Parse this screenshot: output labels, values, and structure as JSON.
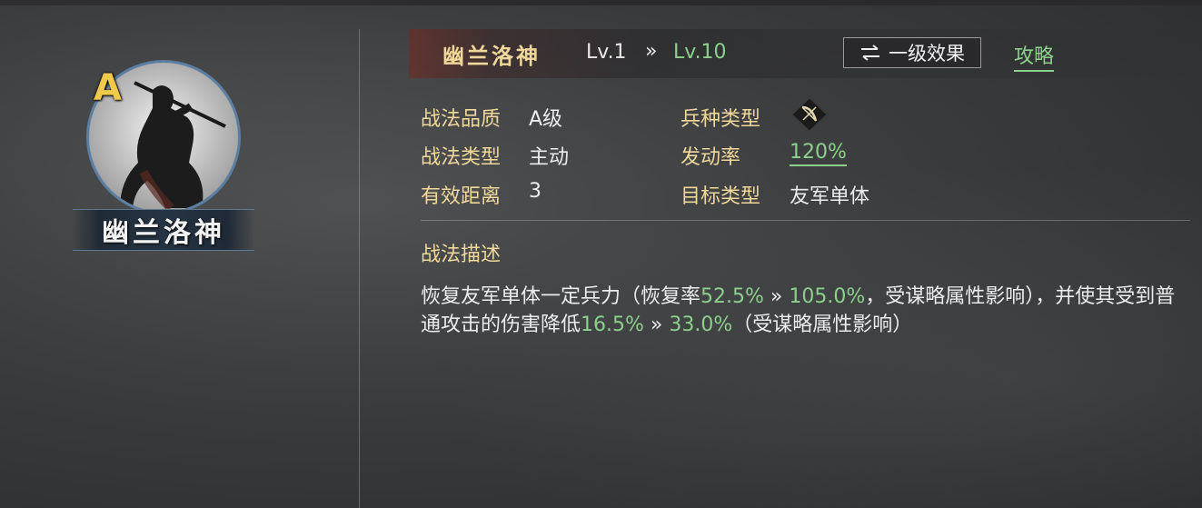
{
  "portrait": {
    "grade": "A",
    "name": "幽兰洛神"
  },
  "header": {
    "skill_name": "幽兰洛神",
    "level_from": "Lv.1",
    "level_arrow": "»",
    "level_to": "Lv.10",
    "effect_button_label": "一级效果",
    "effect_button_icon": "swap-arrows-icon",
    "strategy_link": "攻略"
  },
  "info": {
    "quality_label": "战法品质",
    "quality_value": "A级",
    "type_label": "战法类型",
    "type_value": "主动",
    "range_label": "有效距离",
    "range_value": "3",
    "troop_label": "兵种类型",
    "troop_icon": "bow-icon",
    "rate_label": "发动率",
    "rate_value": "120%",
    "target_label": "目标类型",
    "target_value": "友军单体"
  },
  "description": {
    "title": "战法描述",
    "t1": "恢复友军单体一定兵力（恢复率",
    "v1": "52.5%",
    "a1": " » ",
    "v2": "105.0%",
    "t2": "，受谋略属性影响），并使其受到普通攻击的伤害降低",
    "v3": "16.5%",
    "a2": " » ",
    "v4": "33.0%",
    "t3": "（受谋略属性影响）"
  },
  "colors": {
    "gold": "#f0d79a",
    "green": "#8cd08c",
    "grade": "#f0c94a",
    "ring": "#5a7fa3"
  }
}
